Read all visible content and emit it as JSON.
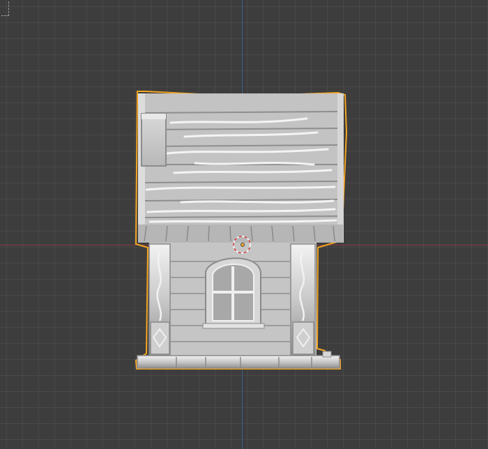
{
  "viewport": {
    "view": "front-orthographic",
    "grid": true,
    "background_color": "#3d3d3d",
    "x_axis_color": "#8a3b45",
    "z_axis_color": "#3c5f8f"
  },
  "selected_object": {
    "kind": "house-model",
    "selected": true,
    "outline_color": "#f5a623",
    "origin_color": "#f5a623"
  },
  "cursor_3d": {
    "ring_colors": [
      "#d63a3a",
      "#ffffff"
    ]
  }
}
